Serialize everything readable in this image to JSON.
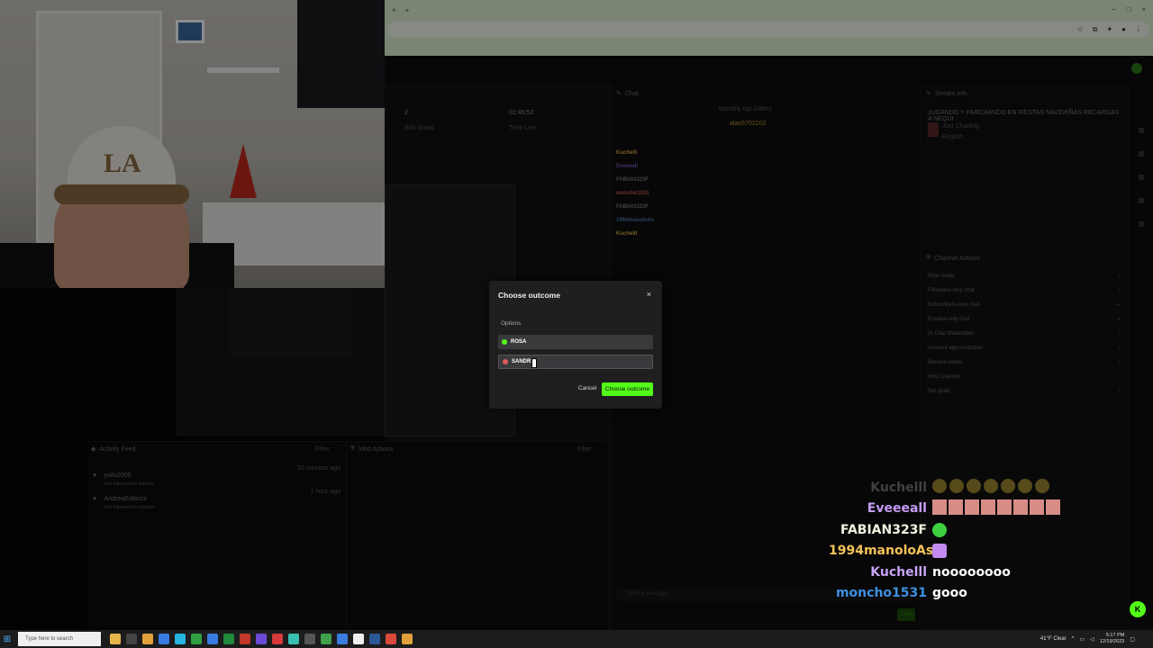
{
  "modal": {
    "title": "Choose outcome",
    "close_glyph": "×",
    "options_label": "Options",
    "options": [
      {
        "label": "ROSA",
        "color": "#53fc18"
      },
      {
        "label": "SANDRA",
        "color": "#e05a5a"
      }
    ],
    "cancel_label": "Cancel",
    "confirm_label": "Choose outcome"
  },
  "dashboard": {
    "stats": [
      {
        "value": "2",
        "label": "Sub Goals"
      },
      {
        "value": "02:46:53",
        "label": "Time Live"
      }
    ],
    "chat": {
      "title": "Chat",
      "top_gifters_label": "Monthly top Gifters",
      "gifter_name": "alan5702202",
      "messages": [
        {
          "user": "Kuchelll",
          "text": "",
          "color": "#d6a64a"
        },
        {
          "user": "Eveeeall",
          "text": "",
          "color": "#7d57c1"
        },
        {
          "user": "FABIAN323F",
          "text": "",
          "color": "#777777"
        },
        {
          "user": "moncho1531",
          "text": "",
          "color": "#c25a5a"
        },
        {
          "user": "FABIAN323F",
          "text": "",
          "color": "#777777"
        },
        {
          "user": "1994manoloAs",
          "text": "",
          "color": "#4f7ab5"
        },
        {
          "user": "Kuchelll",
          "text": "",
          "color": "#d6a64a"
        }
      ],
      "input_placeholder": "Send a message",
      "send_label": "Chat"
    },
    "stream_info": {
      "title": "Stream info",
      "stream_title": "JUGANDO Y PARCHANDO EN FIESTAS NAVIDEÑAS RECARGAS A NEQUI",
      "category": "Just Chatting",
      "language": "English"
    },
    "channel_actions": {
      "title": "Channel Actions",
      "items": [
        "Slow mode",
        "Followers-only chat",
        "Subscribers-only chat",
        "Emotes-only chat",
        "AI Chat Moderation",
        "Account age restriction",
        "Banned words",
        "Host Channel",
        "Set goals"
      ]
    },
    "activity_feed": {
      "title": "Activity Feed",
      "filter_label": "Filter",
      "items": [
        {
          "user": "yollo2000",
          "text": "Just followed the channel",
          "time": "20 minutes ago"
        },
        {
          "user": "AndreaEddiozz",
          "text": "Just followed the channel",
          "time": "1 hour ago"
        }
      ]
    },
    "mod_actions": {
      "title": "Mod Actions",
      "filter_label": "Filter"
    }
  },
  "stream_chat": [
    {
      "user": "Kuchelll",
      "user_color": "#7a7a7a",
      "message": "",
      "emote": "face-emoji-row",
      "faded": true
    },
    {
      "user": "Eveeeall",
      "user_color": "#c69cf5",
      "message": "",
      "emote": "face-photo-row"
    },
    {
      "user": "FABIAN323F",
      "user_color": "#f2f2e0",
      "message": "",
      "emote": "green-blob-emote"
    },
    {
      "user": "1994manoloAs",
      "user_color": "#f5c25a",
      "message": "",
      "emote": "purple-feather-emote"
    },
    {
      "user": "Kuchelll",
      "user_color": "#c7a3f7",
      "message": "noooooooo"
    },
    {
      "user": "moncho1531",
      "user_color": "#3e8fe0",
      "message": "gooo"
    }
  ],
  "taskbar": {
    "search_placeholder": "Type here to search",
    "weather": "41°F Clear",
    "time": "5:17 PM",
    "date": "12/19/2023"
  },
  "colors": {
    "kick_green": "#53fc18",
    "modal_bg": "#1f1f21"
  }
}
